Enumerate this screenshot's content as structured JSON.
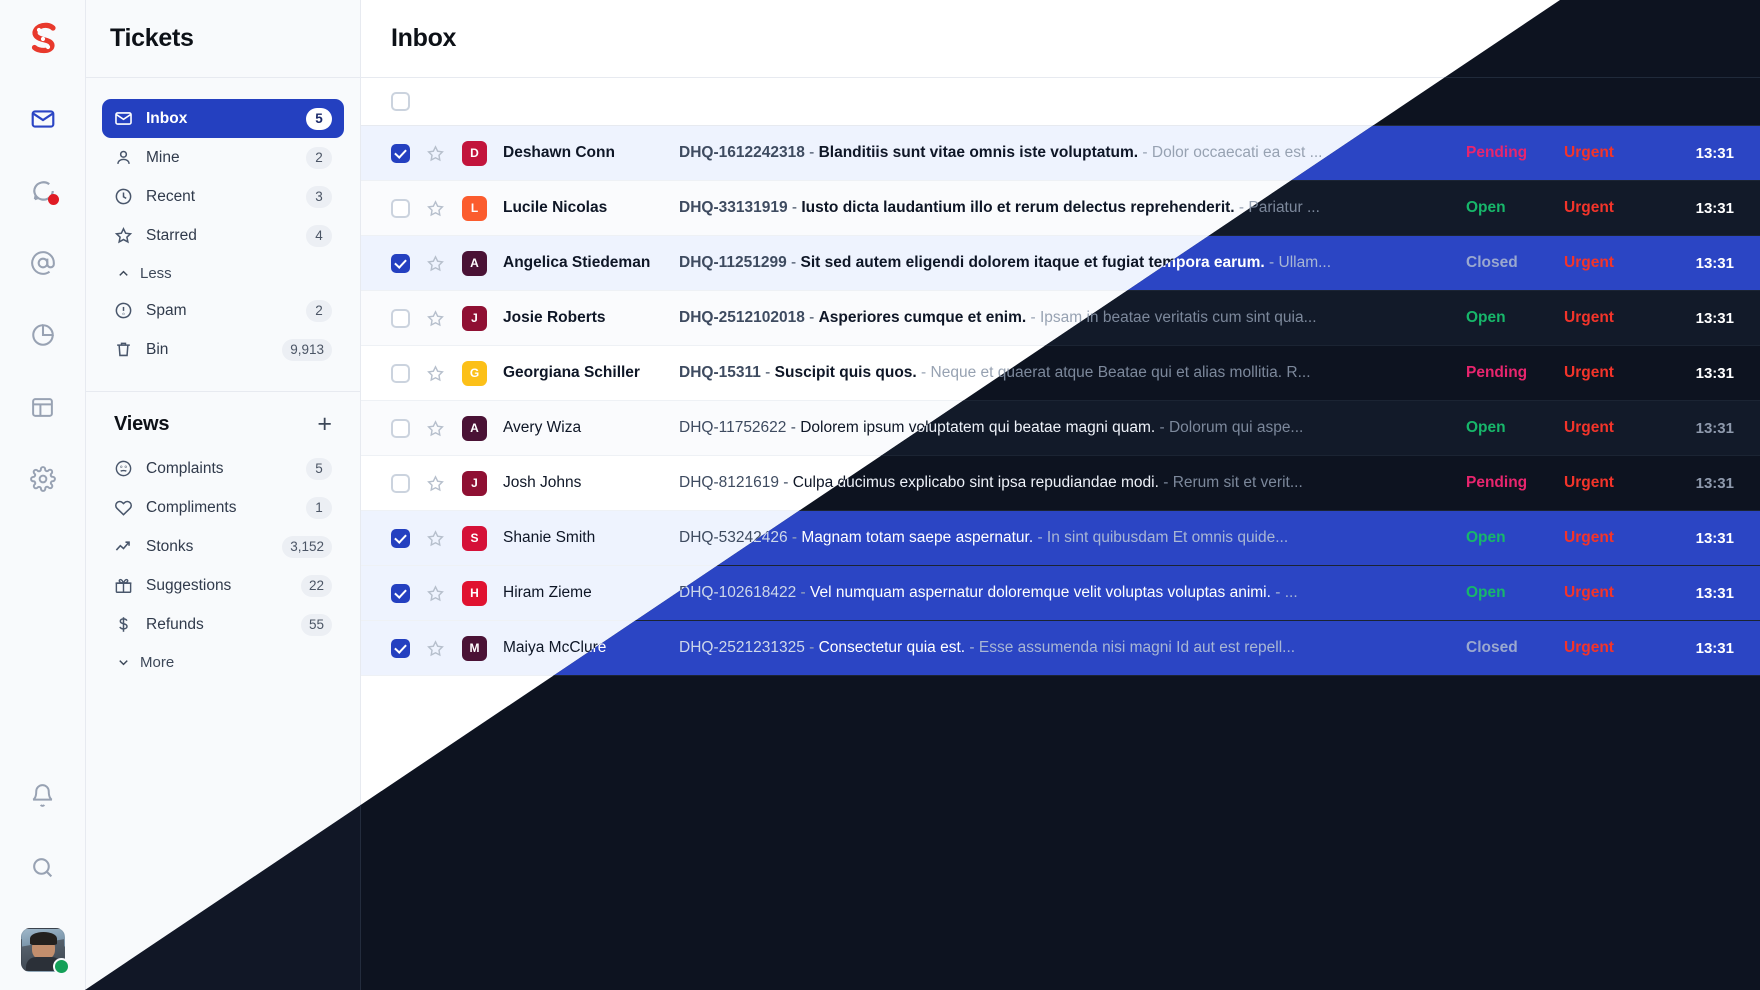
{
  "brand": {
    "logo_letter": "S",
    "logo_color": "#e8392c",
    "accent": "#2440c0"
  },
  "rail": {
    "items": [
      {
        "name": "mail",
        "active": true,
        "dot": false
      },
      {
        "name": "chat",
        "active": false,
        "dot": true
      },
      {
        "name": "mention",
        "active": false,
        "dot": false
      },
      {
        "name": "reports",
        "active": false,
        "dot": false
      },
      {
        "name": "layout",
        "active": false,
        "dot": false
      },
      {
        "name": "settings",
        "active": false,
        "dot": false
      }
    ],
    "bottom": [
      {
        "name": "notifications"
      },
      {
        "name": "search"
      }
    ],
    "avatar_status": "online"
  },
  "sidebar": {
    "title": "Tickets",
    "nav": [
      {
        "label": "Inbox",
        "count": "5",
        "icon": "mail-icon",
        "active": true
      },
      {
        "label": "Mine",
        "count": "2",
        "icon": "person-icon",
        "active": false
      },
      {
        "label": "Recent",
        "count": "3",
        "icon": "clock-icon",
        "active": false
      },
      {
        "label": "Starred",
        "count": "4",
        "icon": "star-icon",
        "active": false
      }
    ],
    "less_label": "Less",
    "nav_extra": [
      {
        "label": "Spam",
        "count": "2",
        "icon": "alert-icon"
      },
      {
        "label": "Bin",
        "count": "9,913",
        "icon": "trash-icon"
      }
    ],
    "views_title": "Views",
    "views_add_label": "+",
    "views": [
      {
        "label": "Complaints",
        "count": "5",
        "icon": "frown-icon"
      },
      {
        "label": "Compliments",
        "count": "1",
        "icon": "heart-icon"
      },
      {
        "label": "Stonks",
        "count": "3,152",
        "icon": "trending-up-icon"
      },
      {
        "label": "Suggestions",
        "count": "22",
        "icon": "gift-icon"
      },
      {
        "label": "Refunds",
        "count": "55",
        "icon": "dollar-icon"
      }
    ],
    "more_label": "More"
  },
  "main": {
    "title": "Inbox",
    "rows": [
      {
        "checked": true,
        "starred": false,
        "unread": true,
        "avatar_letter": "D",
        "avatar_color": "#c2143c",
        "name": "Deshawn Conn",
        "ticket_id": "DHQ-1612242318",
        "subject": "Blanditiis sunt vitae omnis iste voluptatum.",
        "preview": "Dolor occaecati ea est ...",
        "status": "Pending",
        "status_kind": "pending",
        "priority": "Urgent",
        "time": "13:31"
      },
      {
        "checked": false,
        "starred": false,
        "unread": true,
        "avatar_letter": "L",
        "avatar_color": "#fb5c2e",
        "name": "Lucile Nicolas",
        "ticket_id": "DHQ-33131919",
        "subject": "Iusto dicta laudantium illo et rerum delectus reprehenderit.",
        "preview": "Pariatur ...",
        "status": "Open",
        "status_kind": "open",
        "priority": "Urgent",
        "time": "13:31"
      },
      {
        "checked": true,
        "starred": false,
        "unread": true,
        "avatar_letter": "A",
        "avatar_color": "#4a1235",
        "name": "Angelica Stiedemann",
        "ticket_id": "DHQ-11251299",
        "subject": "Sit sed autem eligendi dolorem itaque et fugiat tempora earum.",
        "preview": "Ullam...",
        "status": "Closed",
        "status_kind": "closed",
        "priority": "Urgent",
        "time": "13:31"
      },
      {
        "checked": false,
        "starred": false,
        "unread": true,
        "avatar_letter": "J",
        "avatar_color": "#8f1033",
        "name": "Josie Roberts",
        "ticket_id": "DHQ-2512102018",
        "subject": "Asperiores cumque et enim.",
        "preview": "Ipsam in beatae veritatis cum sint quia...",
        "status": "Open",
        "status_kind": "open",
        "priority": "Urgent",
        "time": "13:31"
      },
      {
        "checked": false,
        "starred": false,
        "unread": true,
        "avatar_letter": "G",
        "avatar_color": "#fcc018",
        "name": "Georgiana Schiller",
        "ticket_id": "DHQ-15311",
        "subject": "Suscipit quis quos.",
        "preview": "Neque et quaerat atque Beatae qui et alias mollitia. R...",
        "status": "Pending",
        "status_kind": "pending",
        "priority": "Urgent",
        "time": "13:31"
      },
      {
        "checked": false,
        "starred": false,
        "unread": false,
        "avatar_letter": "A",
        "avatar_color": "#4a1235",
        "name": "Avery Wiza",
        "ticket_id": "DHQ-11752622",
        "subject": "Dolorem ipsum voluptatem qui beatae magni quam.",
        "preview": "Dolorum qui aspe...",
        "status": "Open",
        "status_kind": "open",
        "priority": "Urgent",
        "time": "13:31"
      },
      {
        "checked": false,
        "starred": false,
        "unread": false,
        "avatar_letter": "J",
        "avatar_color": "#8f1033",
        "name": "Josh Johns",
        "ticket_id": "DHQ-8121619",
        "subject": "Culpa ducimus explicabo sint ipsa repudiandae modi.",
        "preview": "Rerum sit et verit...",
        "status": "Pending",
        "status_kind": "pending",
        "priority": "Urgent",
        "time": "13:31"
      },
      {
        "checked": true,
        "starred": false,
        "unread": false,
        "avatar_letter": "S",
        "avatar_color": "#d51138",
        "name": "Shanie Smith",
        "ticket_id": "DHQ-53242426",
        "subject": "Magnam totam saepe aspernatur.",
        "preview": "In sint quibusdam Et omnis quide...",
        "status": "Open",
        "status_kind": "open",
        "priority": "Urgent",
        "time": "13:31"
      },
      {
        "checked": true,
        "starred": false,
        "unread": false,
        "avatar_letter": "H",
        "avatar_color": "#e01230",
        "name": "Hiram Zieme",
        "ticket_id": "DHQ-102618422",
        "subject": "Vel numquam aspernatur doloremque velit voluptas voluptas animi.",
        "preview": "...",
        "status": "Open",
        "status_kind": "open",
        "priority": "Urgent",
        "time": "13:31"
      },
      {
        "checked": true,
        "starred": false,
        "unread": false,
        "avatar_letter": "M",
        "avatar_color": "#4a1235",
        "name": "Maiya McClure",
        "ticket_id": "DHQ-2521231325",
        "subject": "Consectetur quia est.",
        "preview": "Esse assumenda nisi magni Id aut est repell...",
        "status": "Closed",
        "status_kind": "closed",
        "priority": "Urgent",
        "time": "13:31"
      }
    ]
  }
}
